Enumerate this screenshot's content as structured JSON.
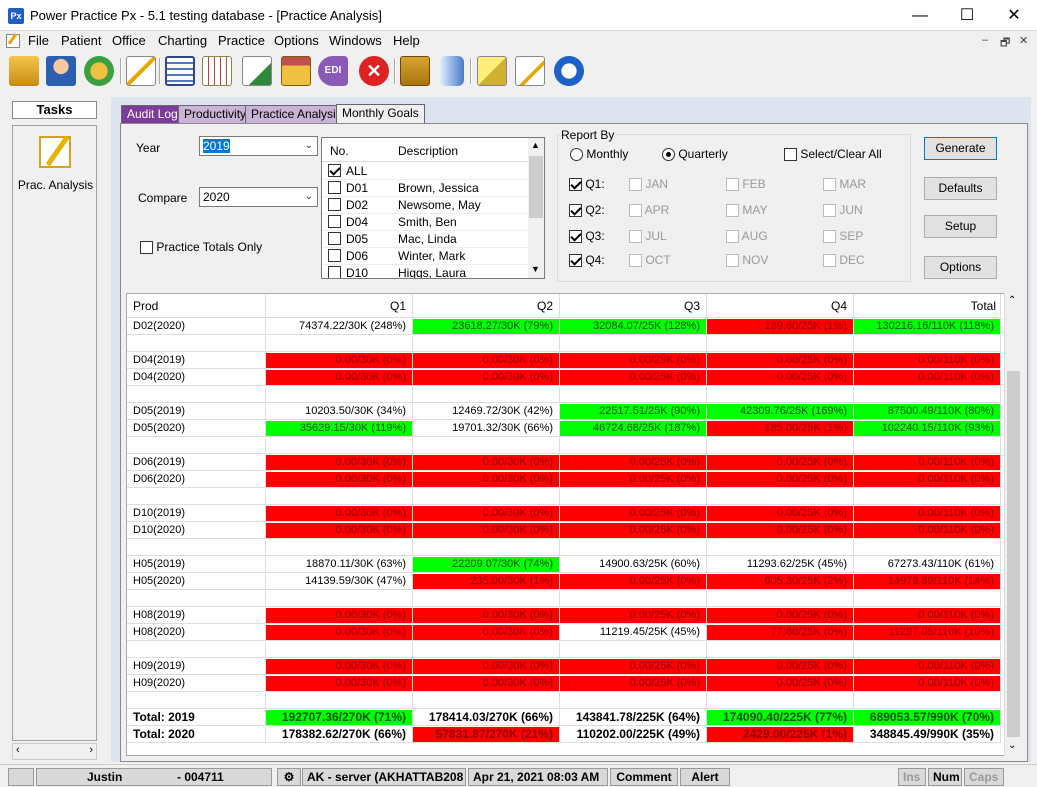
{
  "window": {
    "title": "Power Practice Px - 5.1 testing database - [Practice Analysis]",
    "app_icon": "Px",
    "minimize": "—",
    "maximize": "☐",
    "close": "✕"
  },
  "menu": [
    "File",
    "Patient",
    "Office",
    "Charting",
    "Practice",
    "Options",
    "Windows",
    "Help"
  ],
  "mdi": {
    "min": "–",
    "restore": "🗗",
    "close": "✕"
  },
  "tasks": {
    "title": "Tasks",
    "item": "Prac. Analysis"
  },
  "tabs": [
    "Audit Log",
    "Productivity",
    "Practice Analysis",
    "Monthly Goals"
  ],
  "form": {
    "year_label": "Year",
    "year_value": "2019",
    "compare_label": "Compare",
    "compare_value": "2020",
    "totals_only_label": "Practice Totals Only",
    "list_head_no": "No.",
    "list_head_desc": "Description",
    "providers": [
      {
        "no": "ALL",
        "desc": "",
        "checked": true
      },
      {
        "no": "D01",
        "desc": "Brown, Jessica",
        "checked": false
      },
      {
        "no": "D02",
        "desc": "Newsome, May",
        "checked": false
      },
      {
        "no": "D04",
        "desc": "Smith, Ben",
        "checked": false
      },
      {
        "no": "D05",
        "desc": "Mac, Linda",
        "checked": false
      },
      {
        "no": "D06",
        "desc": "Winter, Mark",
        "checked": false
      },
      {
        "no": "D10",
        "desc": "Higgs, Laura",
        "checked": false
      }
    ],
    "report_by": "Report By",
    "monthly": "Monthly",
    "quarterly": "Quarterly",
    "select_all": "Select/Clear All",
    "quarters": [
      "Q1:",
      "Q2:",
      "Q3:",
      "Q4:"
    ],
    "months": [
      "JAN",
      "FEB",
      "MAR",
      "APR",
      "MAY",
      "JUN",
      "JUL",
      "AUG",
      "SEP",
      "OCT",
      "NOV",
      "DEC"
    ],
    "buttons": {
      "generate": "Generate",
      "defaults": "Defaults",
      "setup": "Setup",
      "options": "Options"
    }
  },
  "grid": {
    "headers": [
      "Prod",
      "Q1",
      "Q2",
      "Q3",
      "Q4",
      "Total"
    ],
    "rows": [
      {
        "name": "D02(2020)",
        "cells": [
          [
            "74374.22/30K (248%)",
            ""
          ],
          [
            "23618.27/30K (79%)",
            "green"
          ],
          [
            "32084.07/25K (128%)",
            "green"
          ],
          [
            "139.60/25K (1%)",
            "red"
          ],
          [
            "130216.16/110K (118%)",
            "green"
          ]
        ]
      },
      {
        "name": "",
        "cells": []
      },
      {
        "name": "D04(2019)",
        "cells": [
          [
            "0.00/30K (0%)",
            "red"
          ],
          [
            "0.00/30K (0%)",
            "red"
          ],
          [
            "0.00/25K (0%)",
            "red"
          ],
          [
            "0.00/25K (0%)",
            "red"
          ],
          [
            "0.00/110K (0%)",
            "red"
          ]
        ]
      },
      {
        "name": "D04(2020)",
        "cells": [
          [
            "0.00/30K (0%)",
            "red"
          ],
          [
            "0.00/30K (0%)",
            "red"
          ],
          [
            "0.00/25K (0%)",
            "red"
          ],
          [
            "0.00/25K (0%)",
            "red"
          ],
          [
            "0.00/110K (0%)",
            "red"
          ]
        ]
      },
      {
        "name": "",
        "cells": []
      },
      {
        "name": "D05(2019)",
        "cells": [
          [
            "10203.50/30K (34%)",
            ""
          ],
          [
            "12469.72/30K (42%)",
            ""
          ],
          [
            "22517.51/25K (90%)",
            "green"
          ],
          [
            "42309.76/25K (169%)",
            "green"
          ],
          [
            "87500.49/110K (80%)",
            "green"
          ]
        ]
      },
      {
        "name": "D05(2020)",
        "cells": [
          [
            "35629.15/30K (119%)",
            "green"
          ],
          [
            "19701.32/30K (66%)",
            ""
          ],
          [
            "46724.68/25K (187%)",
            "green"
          ],
          [
            "185.00/25K (1%)",
            "red"
          ],
          [
            "102240.15/110K (93%)",
            "green"
          ]
        ]
      },
      {
        "name": "",
        "cells": []
      },
      {
        "name": "D06(2019)",
        "cells": [
          [
            "0.00/30K (0%)",
            "red"
          ],
          [
            "0.00/30K (0%)",
            "red"
          ],
          [
            "0.00/25K (0%)",
            "red"
          ],
          [
            "0.00/25K (0%)",
            "red"
          ],
          [
            "0.00/110K (0%)",
            "red"
          ]
        ]
      },
      {
        "name": "D06(2020)",
        "cells": [
          [
            "0.00/30K (0%)",
            "red"
          ],
          [
            "0.00/30K (0%)",
            "red"
          ],
          [
            "0.00/25K (0%)",
            "red"
          ],
          [
            "0.00/25K (0%)",
            "red"
          ],
          [
            "0.00/110K (0%)",
            "red"
          ]
        ]
      },
      {
        "name": "",
        "cells": []
      },
      {
        "name": "D10(2019)",
        "cells": [
          [
            "0.00/30K (0%)",
            "red"
          ],
          [
            "0.00/30K (0%)",
            "red"
          ],
          [
            "0.00/25K (0%)",
            "red"
          ],
          [
            "0.00/25K (0%)",
            "red"
          ],
          [
            "0.00/110K (0%)",
            "red"
          ]
        ]
      },
      {
        "name": "D10(2020)",
        "cells": [
          [
            "0.00/30K (0%)",
            "red"
          ],
          [
            "0.00/30K (0%)",
            "red"
          ],
          [
            "0.00/25K (0%)",
            "red"
          ],
          [
            "0.00/25K (0%)",
            "red"
          ],
          [
            "0.00/110K (0%)",
            "red"
          ]
        ]
      },
      {
        "name": "",
        "cells": []
      },
      {
        "name": "H05(2019)",
        "cells": [
          [
            "18870.11/30K (63%)",
            ""
          ],
          [
            "22209.07/30K (74%)",
            "green"
          ],
          [
            "14900.63/25K (60%)",
            ""
          ],
          [
            "11293.62/25K (45%)",
            ""
          ],
          [
            "67273.43/110K (61%)",
            ""
          ]
        ]
      },
      {
        "name": "H05(2020)",
        "cells": [
          [
            "14139.59/30K (47%)",
            ""
          ],
          [
            "235.00/30K (1%)",
            "red"
          ],
          [
            "0.00/25K (0%)",
            "red"
          ],
          [
            "605.30/25K (2%)",
            "red"
          ],
          [
            "14979.89/110K (14%)",
            "red"
          ]
        ]
      },
      {
        "name": "",
        "cells": []
      },
      {
        "name": "H08(2019)",
        "cells": [
          [
            "0.00/30K (0%)",
            "red"
          ],
          [
            "0.00/30K (0%)",
            "red"
          ],
          [
            "0.00/25K (0%)",
            "red"
          ],
          [
            "0.00/25K (0%)",
            "red"
          ],
          [
            "0.00/110K (0%)",
            "red"
          ]
        ]
      },
      {
        "name": "H08(2020)",
        "cells": [
          [
            "0.00/30K (0%)",
            "red"
          ],
          [
            "0.00/30K (0%)",
            "red"
          ],
          [
            "11219.45/25K (45%)",
            ""
          ],
          [
            "77.60/25K (0%)",
            "red"
          ],
          [
            "11297.05/110K (10%)",
            "red"
          ]
        ]
      },
      {
        "name": "",
        "cells": []
      },
      {
        "name": "H09(2019)",
        "cells": [
          [
            "0.00/30K (0%)",
            "red"
          ],
          [
            "0.00/30K (0%)",
            "red"
          ],
          [
            "0.00/25K (0%)",
            "red"
          ],
          [
            "0.00/25K (0%)",
            "red"
          ],
          [
            "0.00/110K (0%)",
            "red"
          ]
        ]
      },
      {
        "name": "H09(2020)",
        "cells": [
          [
            "0.00/30K (0%)",
            "red"
          ],
          [
            "0.00/30K (0%)",
            "red"
          ],
          [
            "0.00/25K (0%)",
            "red"
          ],
          [
            "0.00/25K (0%)",
            "red"
          ],
          [
            "0.00/110K (0%)",
            "red"
          ]
        ]
      },
      {
        "name": "",
        "cells": []
      },
      {
        "name": "Total: 2019",
        "bold": true,
        "cells": [
          [
            "192707.36/270K (71%)",
            "green"
          ],
          [
            "178414.03/270K (66%)",
            ""
          ],
          [
            "143841.78/225K (64%)",
            ""
          ],
          [
            "174090.40/225K (77%)",
            "green"
          ],
          [
            "689053.57/990K (70%)",
            "green"
          ]
        ]
      },
      {
        "name": "Total: 2020",
        "bold": true,
        "cells": [
          [
            "178382.62/270K (66%)",
            ""
          ],
          [
            "57831.87/270K (21%)",
            "red"
          ],
          [
            "110202.00/225K (49%)",
            ""
          ],
          [
            "2429.00/225K (1%)",
            "red"
          ],
          [
            "348845.49/990K (35%)",
            ""
          ]
        ]
      }
    ]
  },
  "status": {
    "user": "Justin",
    "id": "- 004711",
    "server": "AK - server (AKHATTAB208",
    "datetime": "Apr 21, 2021 08:03 AM",
    "comment": "Comment",
    "alert": "Alert",
    "ins": "Ins",
    "num": "Num",
    "caps": "Caps"
  },
  "colors": {
    "red": "#ff0000",
    "green": "#00ff00",
    "tab_purple": "#7b3b9a"
  }
}
